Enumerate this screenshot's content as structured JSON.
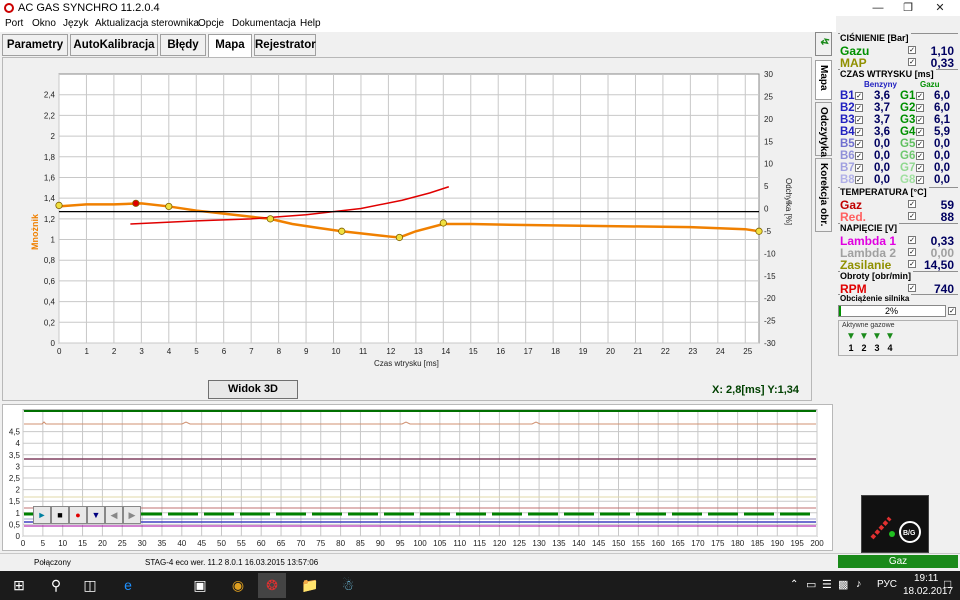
{
  "window": {
    "title": "AC GAS SYNCHRO  11.2.0.4"
  },
  "menu": [
    "Port",
    "Okno",
    "Język",
    "Aktualizacja sterownika",
    "Opcje",
    "Dokumentacja",
    "Help"
  ],
  "tabs": [
    "Parametry",
    "AutoKalibracja",
    "Błędy",
    "Mapa",
    "Rejestrator"
  ],
  "vtabs": [
    "Mapa",
    "Odczytyka",
    "Korekcja obr."
  ],
  "map_chart": {
    "type": "line",
    "xlabel": "Czas wtrysku [ms]",
    "ylabel": "Mnożnik",
    "y2label": "Odchyłka [%]",
    "xticks": [
      "0",
      "1",
      "2",
      "3",
      "4",
      "5",
      "6",
      "7",
      "8",
      "9",
      "10",
      "11",
      "12",
      "13",
      "14",
      "15",
      "16",
      "17",
      "18",
      "19",
      "20",
      "21",
      "22",
      "23",
      "24",
      "25"
    ],
    "yticks": [
      "0",
      "0,2",
      "0,4",
      "0,6",
      "0,8",
      "1",
      "1,2",
      "1,4",
      "1,6",
      "1,8",
      "2",
      "2,2",
      "2,4"
    ],
    "y2ticks": [
      "-30",
      "-25",
      "-20",
      "-15",
      "-10",
      "-5",
      "0",
      "5",
      "10",
      "15",
      "20",
      "25",
      "30"
    ],
    "xlim": [
      0,
      25.5
    ],
    "ylim": [
      0,
      2.6
    ],
    "series": [
      {
        "color": "#f08000",
        "x": [
          0,
          1,
          2,
          3,
          4,
          5,
          6,
          7,
          7.7,
          8.5,
          9.5,
          10.3,
          11,
          12,
          12.4,
          13,
          14,
          15,
          17,
          20,
          23,
          25,
          25.5
        ],
        "y": [
          1.32,
          1.34,
          1.34,
          1.35,
          1.32,
          1.28,
          1.25,
          1.22,
          1.2,
          1.15,
          1.11,
          1.08,
          1.06,
          1.03,
          1.02,
          1.08,
          1.15,
          1.15,
          1.14,
          1.13,
          1.12,
          1.1,
          1.08
        ]
      },
      {
        "color": "#e00000",
        "x": [
          2.6,
          5,
          7,
          9,
          11,
          12.5,
          13.5,
          14.2
        ],
        "y": [
          1.15,
          1.18,
          1.2,
          1.24,
          1.3,
          1.38,
          1.45,
          1.51
        ]
      },
      {
        "color": "#000000",
        "x": [
          0,
          25.5
        ],
        "y": [
          1.27,
          1.27
        ]
      }
    ],
    "points": [
      {
        "x": 0,
        "y": 1.33,
        "color": "#f0e040"
      },
      {
        "x": 2.8,
        "y": 1.35,
        "color": "#e00000"
      },
      {
        "x": 4,
        "y": 1.32,
        "color": "#f0e040"
      },
      {
        "x": 7.7,
        "y": 1.2,
        "color": "#f0e040"
      },
      {
        "x": 10.3,
        "y": 1.08,
        "color": "#f0e040"
      },
      {
        "x": 12.4,
        "y": 1.02,
        "color": "#f0e040"
      },
      {
        "x": 14,
        "y": 1.16,
        "color": "#f0e040"
      },
      {
        "x": 25.5,
        "y": 1.08,
        "color": "#f0e040"
      }
    ]
  },
  "widok_button": "Widok 3D",
  "coord_readout": "X:  2,8[ms]  Y:1,34",
  "recorder": {
    "yticks": [
      "0",
      "0,5",
      "1",
      "1,5",
      "2",
      "2,5",
      "3",
      "3,5",
      "4",
      "4,5"
    ],
    "xticks": [
      "0",
      "5",
      "10",
      "15",
      "20",
      "25",
      "30",
      "35",
      "40",
      "45",
      "50",
      "55",
      "60",
      "65",
      "70",
      "75",
      "80",
      "85",
      "90",
      "95",
      "100",
      "105",
      "110",
      "115",
      "120",
      "125",
      "130",
      "135",
      "140",
      "145",
      "150",
      "155",
      "160",
      "165",
      "170",
      "175",
      "180",
      "185",
      "190",
      "195",
      "200"
    ],
    "xlim": [
      0,
      200
    ],
    "ylim": [
      0,
      5
    ]
  },
  "rp": {
    "pressure_title": "CIŚNIENIE [Bar]",
    "pressure": [
      {
        "label": "Gazu",
        "value": "1,10",
        "color": "#009000"
      },
      {
        "label": "MAP",
        "value": "0,33",
        "color": "#909000"
      }
    ],
    "inj_title": "CZAS WTRYSKU [ms]",
    "benzyny": "Benzyny",
    "gazu": "Gazu",
    "benz": [
      {
        "l": "B1",
        "v": "3,6"
      },
      {
        "l": "B2",
        "v": "3,7"
      },
      {
        "l": "B3",
        "v": "3,7"
      },
      {
        "l": "B4",
        "v": "3,6"
      },
      {
        "l": "B5",
        "v": "0,0"
      },
      {
        "l": "B6",
        "v": "0,0"
      },
      {
        "l": "B7",
        "v": "0,0"
      },
      {
        "l": "B8",
        "v": "0,0"
      }
    ],
    "gas": [
      {
        "l": "G1",
        "v": "6,0"
      },
      {
        "l": "G2",
        "v": "6,0"
      },
      {
        "l": "G3",
        "v": "6,1"
      },
      {
        "l": "G4",
        "v": "5,9"
      },
      {
        "l": "G5",
        "v": "0,0"
      },
      {
        "l": "G6",
        "v": "0,0"
      },
      {
        "l": "G7",
        "v": "0,0"
      },
      {
        "l": "G8",
        "v": "0,0"
      }
    ],
    "temp_title": "TEMPERATURA [°C]",
    "temp": [
      {
        "label": "Gaz",
        "value": "59",
        "color": "#c00000"
      },
      {
        "label": "Red.",
        "value": "88",
        "color": "#ff6060"
      }
    ],
    "volt_title": "NAPIĘCIE [V]",
    "volt": [
      {
        "label": "Lambda 1",
        "value": "0,33",
        "color": "#e000e0"
      },
      {
        "label": "Lambda 2",
        "value": "0,00",
        "color": "#a0a0a0"
      },
      {
        "label": "Zasilanie",
        "value": "14,50",
        "color": "#909000"
      }
    ],
    "rpm_title": "Obroty [obr/min]",
    "rpm": {
      "label": "RPM",
      "value": "740"
    },
    "load_title": "Obciążenie silnika",
    "load": "2%",
    "load_fraction": 0.02,
    "active_title": "Aktywne gazowe",
    "active": [
      "1",
      "2",
      "3",
      "4"
    ]
  },
  "ecu": {
    "label": "B/G"
  },
  "status": {
    "conn": "Połączony",
    "ecu": "STAG-4 eco   wer. 11.2  8.0.1   16.03.2015 13:57:06",
    "mode": "Gaz"
  },
  "taskbar": {
    "lang": "РУС",
    "time": "19:11",
    "date": "18.02.2017"
  }
}
